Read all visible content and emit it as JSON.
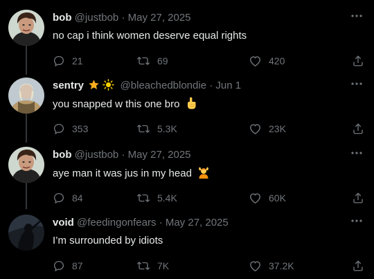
{
  "tweets": [
    {
      "name": "bob",
      "handle": "@justbob",
      "separator": "·",
      "date": "May 27, 2025",
      "text": "no cap i think women deserve equal rights",
      "replies": "21",
      "retweets": "69",
      "likes": "420",
      "avatar": "bob-avatar"
    },
    {
      "name": "sentry",
      "handle": "@bleachedblondie",
      "separator": "·",
      "date": "Jun 1",
      "text": "you snapped w this one bro",
      "emoji": "pointing-up-icon",
      "badges": [
        "star-icon",
        "sun-icon"
      ],
      "replies": "353",
      "retweets": "5.3K",
      "likes": "23K",
      "avatar": "sentry-avatar"
    },
    {
      "name": "bob",
      "handle": "@justbob",
      "separator": "·",
      "date": "May 27, 2025",
      "text": "aye man it was jus in my head",
      "emoji": "person-gesturing-ok-icon",
      "replies": "84",
      "retweets": "5.4K",
      "likes": "60K",
      "avatar": "bob-avatar"
    },
    {
      "name": "void",
      "handle": "@feedingonfears",
      "separator": "·",
      "date": "May 27, 2025",
      "text": "I’m surrounded by idiots",
      "replies": "87",
      "retweets": "7K",
      "likes": "37.2K",
      "avatar": "void-avatar"
    }
  ],
  "colors": {
    "background": "#000000",
    "text": "#e7e9ea",
    "muted": "#71767b",
    "rail": "#333639",
    "badge_star": "#ffad1f",
    "badge_sun": "#ffd000"
  }
}
